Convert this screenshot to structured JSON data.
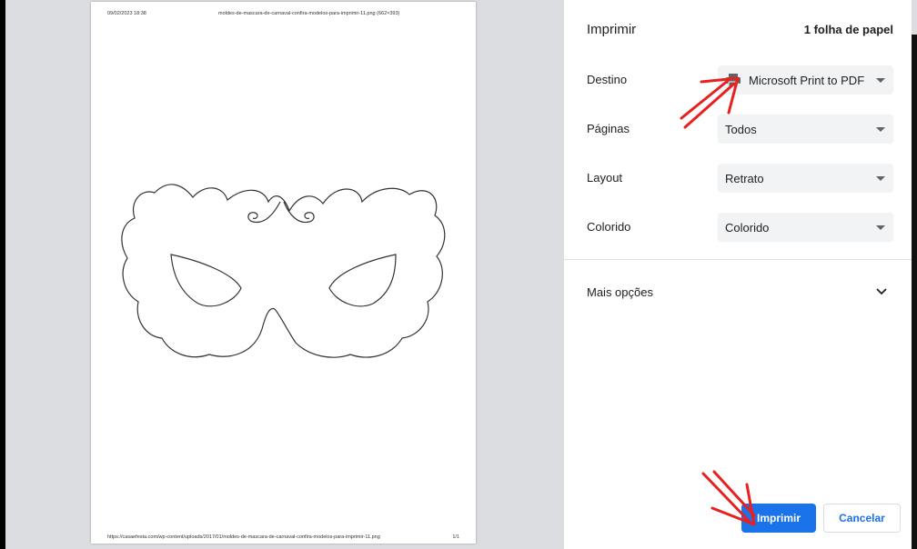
{
  "preview": {
    "header_date": "09/02/2023 18:38",
    "header_title": "moldes-de-mascara-de-carnaval-confira-modelos-para-imprimir-11.png (662×393)",
    "footer_url": "https://casaefesta.com/wp-content/uploads/2017/01/moldes-de-mascara-de-carnaval-confira-modelos-para-imprimir-11.png",
    "footer_page": "1/1"
  },
  "panel": {
    "title": "Imprimir",
    "sheet_count": "1 folha de papel",
    "rows": [
      {
        "label": "Destino",
        "value": "Microsoft Print to PDF",
        "icon": "printer-icon"
      },
      {
        "label": "Páginas",
        "value": "Todos"
      },
      {
        "label": "Layout",
        "value": "Retrato"
      },
      {
        "label": "Colorido",
        "value": "Colorido"
      }
    ],
    "more_options": "Mais opções",
    "print_button": "Imprimir",
    "cancel_button": "Cancelar"
  },
  "colors": {
    "accent": "#1a73e8",
    "annotation_red": "#e8201f"
  }
}
